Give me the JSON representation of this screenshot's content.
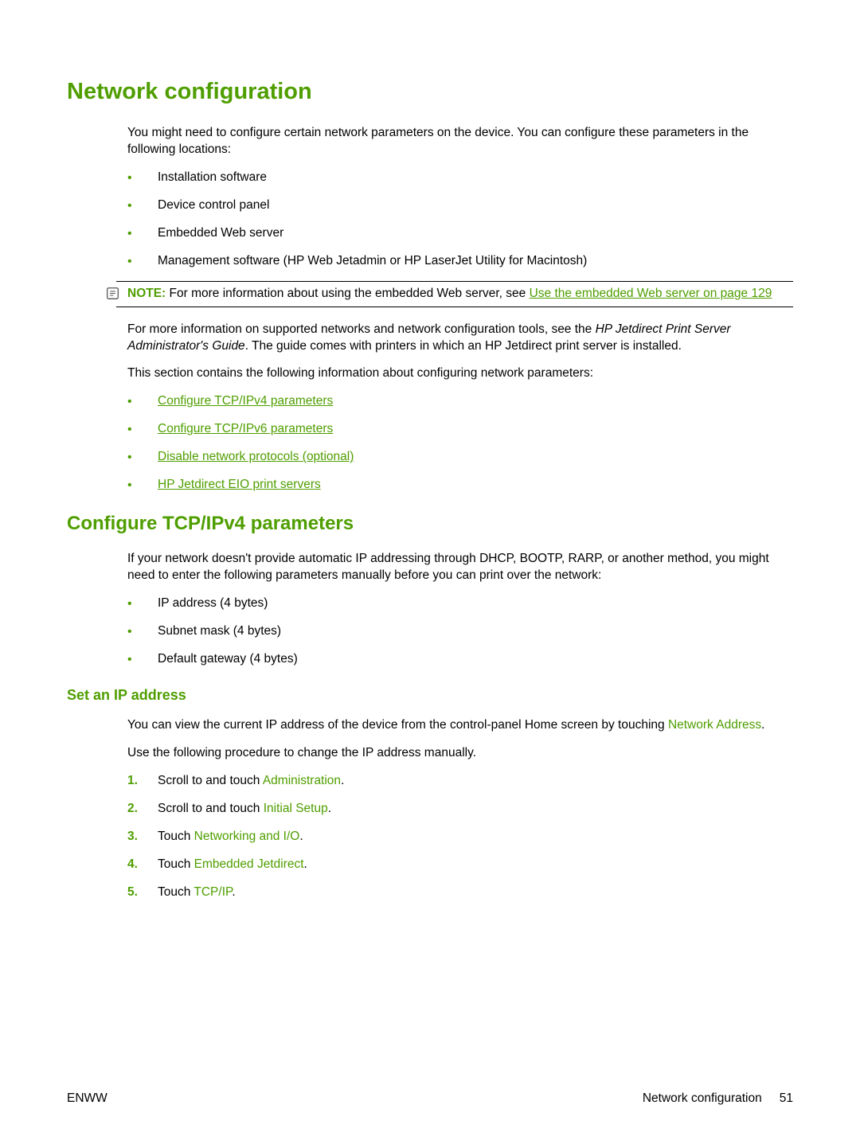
{
  "h1": "Network configuration",
  "intro": "You might need to configure certain network parameters on the device. You can configure these parameters in the following locations:",
  "locations": [
    "Installation software",
    "Device control panel",
    "Embedded Web server",
    "Management software (HP Web Jetadmin or HP LaserJet Utility for Macintosh)"
  ],
  "note": {
    "label": "NOTE:",
    "before": "   For more information about using the embedded Web server, see ",
    "link": "Use the embedded Web server on page 129"
  },
  "para2a": "For more information on supported networks and network configuration tools, see the ",
  "para2_italic": "HP Jetdirect Print Server Administrator's Guide",
  "para2b": ". The guide comes with printers in which an HP Jetdirect print server is installed.",
  "para3": "This section contains the following information about configuring network parameters:",
  "toc": [
    "Configure TCP/IPv4 parameters",
    "Configure TCP/IPv6 parameters",
    "Disable network protocols (optional)",
    "HP Jetdirect EIO print servers"
  ],
  "h2": "Configure TCP/IPv4 parameters",
  "h2_intro": "If your network doesn't provide automatic IP addressing through DHCP, BOOTP, RARP, or another method, you might need to enter the following parameters manually before you can print over the network:",
  "manual_params": [
    "IP address (4 bytes)",
    "Subnet mask (4 bytes)",
    "Default gateway (4 bytes)"
  ],
  "h3": "Set an IP address",
  "ip_intro_a": "You can view the current IP address of the device from the control-panel Home screen by touching ",
  "ip_intro_term": "Network Address",
  "ip_intro_b": ".",
  "ip_proc_lead": "Use the following procedure to change the IP address manually.",
  "steps": [
    {
      "pre": "Scroll to and touch ",
      "term": "Administration",
      "post": "."
    },
    {
      "pre": "Scroll to and touch ",
      "term": "Initial Setup",
      "post": "."
    },
    {
      "pre": "Touch ",
      "term": "Networking and I/O",
      "post": "."
    },
    {
      "pre": "Touch ",
      "term": "Embedded Jetdirect",
      "post": "."
    },
    {
      "pre": "Touch ",
      "term": "TCP/IP",
      "post": "."
    }
  ],
  "footer": {
    "left": "ENWW",
    "right_text": "Network configuration",
    "page_num": "51"
  }
}
